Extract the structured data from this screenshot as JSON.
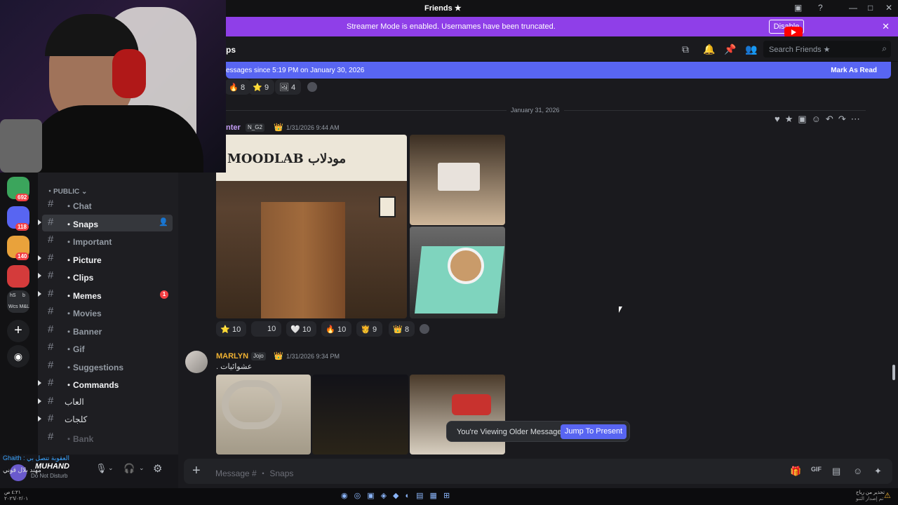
{
  "window": {
    "title": "Friends ★",
    "controls": [
      "—",
      "□",
      "✕"
    ]
  },
  "streamer_banner": {
    "text": "Streamer Mode is enabled. Usernames have been truncated.",
    "button": "Disable",
    "close": "✕"
  },
  "header": {
    "channel_name_fragment": "ps",
    "search_placeholder": "Search Friends ★"
  },
  "new_messages": {
    "text": "essages since 5:19 PM on January 30, 2026",
    "action": "Mark As Read"
  },
  "top_reactions": [
    {
      "emoji": "🔥",
      "count": "8"
    },
    {
      "emoji": "⭐",
      "count": "9"
    },
    {
      "emoji": "🖼",
      "count": "4"
    }
  ],
  "date_divider": "January 31, 2026",
  "message1": {
    "author": "nter",
    "tag": "N_G2",
    "crown": "👑",
    "timestamp": "1/31/2026 9:44 AM",
    "sign_text": "MOODLAB مودلاب",
    "reactions": [
      {
        "emoji": "⭐",
        "count": "10"
      },
      {
        "emoji": "",
        "count": "10"
      },
      {
        "emoji": "🤍",
        "count": "10"
      },
      {
        "emoji": "🔥",
        "count": "10"
      },
      {
        "emoji": "🫅",
        "count": "9"
      },
      {
        "emoji": "👑",
        "count": "8"
      }
    ]
  },
  "message2": {
    "author": "MARLYN",
    "tag": "Jojo",
    "crown": "👑",
    "timestamp": "1/31/2026 9:34 PM",
    "text": "عشوائيات ."
  },
  "older_banner": {
    "text": "You're Viewing Older Messages",
    "button": "Jump To Present"
  },
  "composer": {
    "placeholder": "Message # ・ Snaps"
  },
  "servers": [
    {
      "badge": "692",
      "color": "#3ba55c"
    },
    {
      "badge": "118",
      "color": "#5865f2"
    },
    {
      "badge": "140",
      "color": "#e9a23b"
    },
    {
      "badge": "",
      "color": "#d43b3b"
    },
    {
      "label": "Wcs M&L",
      "color": "#2b2d31"
    }
  ],
  "server_rail_labels": {
    "hs": "hS",
    "b": "b",
    "wcs": "Wcs M&L"
  },
  "category": "・PUBLIC ⌄",
  "channels": [
    {
      "name": "・Chat",
      "style": "muted",
      "arrow": false,
      "selected": false,
      "badge": ""
    },
    {
      "name": "・Snaps",
      "style": "bold",
      "arrow": true,
      "selected": true,
      "badge": ""
    },
    {
      "name": "・Important",
      "style": "muted",
      "arrow": false,
      "selected": false,
      "badge": ""
    },
    {
      "name": "・Picture",
      "style": "bold",
      "arrow": true,
      "selected": false,
      "badge": ""
    },
    {
      "name": "・Clips",
      "style": "bold",
      "arrow": true,
      "selected": false,
      "badge": ""
    },
    {
      "name": "・Memes",
      "style": "bold",
      "arrow": true,
      "selected": false,
      "badge": "1"
    },
    {
      "name": "・Movies",
      "style": "muted",
      "arrow": false,
      "selected": false,
      "badge": ""
    },
    {
      "name": "・Banner",
      "style": "muted",
      "arrow": false,
      "selected": false,
      "badge": ""
    },
    {
      "name": "・Gif",
      "style": "muted",
      "arrow": false,
      "selected": false,
      "badge": ""
    },
    {
      "name": "・Suggestions",
      "style": "muted",
      "arrow": false,
      "selected": false,
      "badge": ""
    },
    {
      "name": "・Commands",
      "style": "bold",
      "arrow": true,
      "selected": false,
      "badge": ""
    },
    {
      "name": "العاب",
      "style": "normal",
      "arrow": true,
      "selected": false,
      "badge": ""
    },
    {
      "name": "كلجات",
      "style": "normal",
      "arrow": true,
      "selected": false,
      "badge": ""
    },
    {
      "name": "・Bank",
      "style": "faded",
      "arrow": false,
      "selected": false,
      "badge": ""
    }
  ],
  "user": {
    "name": "MUHAND",
    "status": "Do Not Disturb",
    "voice_line": "Ghaith : العقوبة تتصل بي",
    "voice_line2": "مهند بلال قوني"
  },
  "taskbar": {
    "left_time": "٤:٢١ ص",
    "left_date": "٢٠٢٦/٠٢/٠١",
    "right_text": "تحذير من رياح",
    "right_text2": "تم إصدار التنو"
  },
  "colors": {
    "accent": "#5865f2",
    "banner": "#8f3fe8",
    "mention_badge": "#f23f43",
    "author1": "#c39cf5",
    "author2": "#f0b232"
  }
}
